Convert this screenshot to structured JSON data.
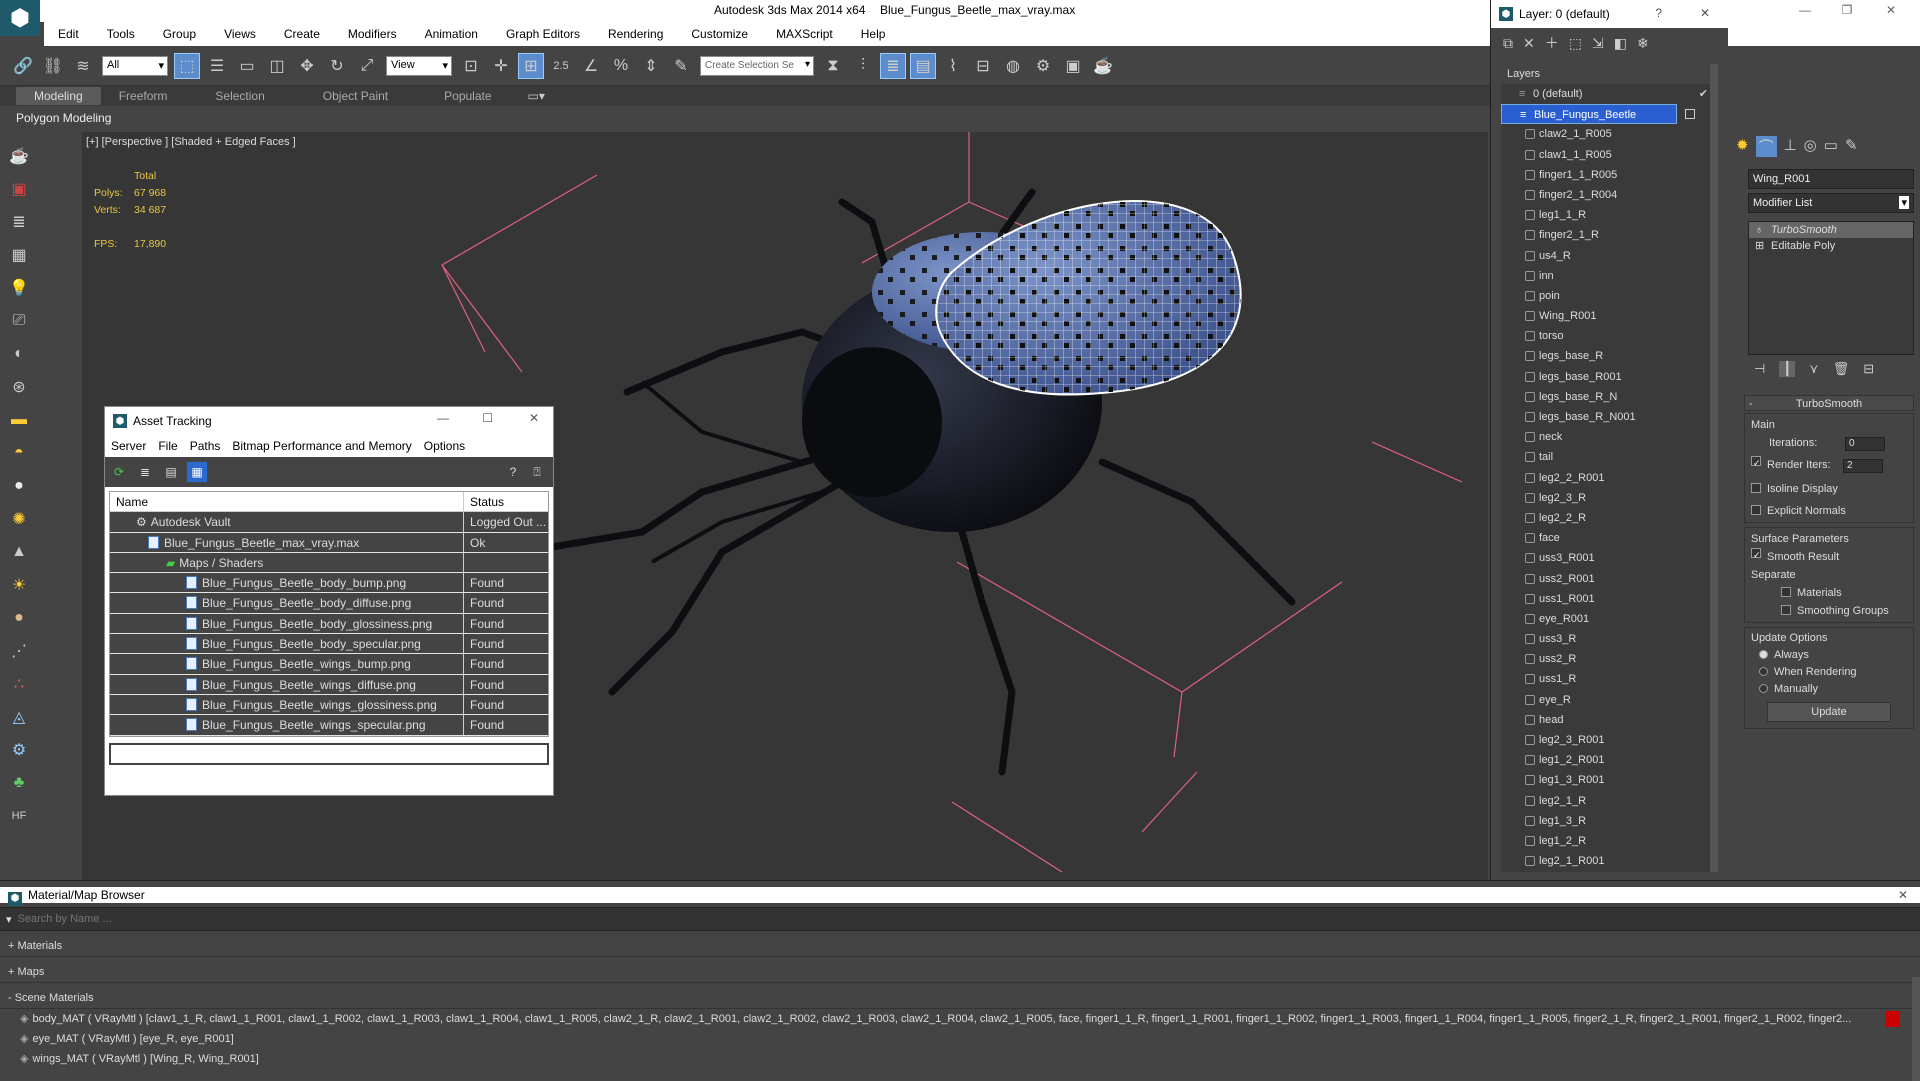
{
  "app": {
    "title": "Autodesk 3ds Max  2014 x64",
    "file": "Blue_Fungus_Beetle_max_vray.max"
  },
  "menu": [
    "Edit",
    "Tools",
    "Group",
    "Views",
    "Create",
    "Modifiers",
    "Animation",
    "Graph Editors",
    "Rendering",
    "Customize",
    "MAXScript",
    "Help"
  ],
  "toolbar": {
    "selection_filter": "All",
    "ref_coord": "View",
    "snap_value": "2.5",
    "named_selection": "Create Selection Se"
  },
  "ribbon_tabs": [
    "Modeling",
    "Freeform",
    "Selection",
    "Object Paint",
    "Populate"
  ],
  "polygon_modeling": "Polygon Modeling",
  "viewport": {
    "label": "[+] [Perspective ] [Shaded + Edged Faces ]",
    "stats": {
      "total_label": "Total",
      "polys_label": "Polys:",
      "polys": "67 968",
      "verts_label": "Verts:",
      "verts": "34 687",
      "fps_label": "FPS:",
      "fps": "17,890"
    }
  },
  "layers_panel": {
    "title": "Layer: 0 (default)",
    "help": "?",
    "header": "Layers",
    "default_layer": "0 (default)",
    "selected_layer": "Blue_Fungus_Beetle",
    "items": [
      "claw2_1_R005",
      "claw1_1_R005",
      "finger1_1_R005",
      "finger2_1_R004",
      "leg1_1_R",
      "finger2_1_R",
      "us4_R",
      "inn",
      "poin",
      "Wing_R001",
      "torso",
      "legs_base_R",
      "legs_base_R001",
      "legs_base_R_N",
      "legs_base_R_N001",
      "neck",
      "tail",
      "leg2_2_R001",
      "leg2_3_R",
      "leg2_2_R",
      "face",
      "uss3_R001",
      "uss2_R001",
      "uss1_R001",
      "eye_R001",
      "uss3_R",
      "uss2_R",
      "uss1_R",
      "eye_R",
      "head",
      "leg2_3_R001",
      "leg1_2_R001",
      "leg1_3_R001",
      "leg2_1_R",
      "leg1_3_R",
      "leg1_2_R",
      "leg2_1_R001"
    ]
  },
  "command_panel": {
    "object_name": "Wing_R001",
    "modifier_list": "Modifier List",
    "stack": [
      "TurboSmooth",
      "Editable Poly"
    ],
    "rollout_title": "TurboSmooth",
    "main_label": "Main",
    "iterations_label": "Iterations:",
    "iterations": "0",
    "render_iters_label": "Render Iters:",
    "render_iters": "2",
    "isoline": "Isoline Display",
    "explicit_normals": "Explicit Normals",
    "surface_params": "Surface Parameters",
    "smooth_result": "Smooth Result",
    "separate": "Separate",
    "materials": "Materials",
    "smoothing_groups": "Smoothing Groups",
    "update_options": "Update Options",
    "always": "Always",
    "when_rendering": "When Rendering",
    "manually": "Manually",
    "update_button": "Update"
  },
  "asset_tracking": {
    "title": "Asset Tracking",
    "menu": [
      "Server",
      "File",
      "Paths",
      "Bitmap Performance and Memory",
      "Options"
    ],
    "col_name": "Name",
    "col_status": "Status",
    "rows": [
      {
        "name": "Autodesk Vault",
        "status": "Logged Out ..."
      },
      {
        "name": "Blue_Fungus_Beetle_max_vray.max",
        "status": "Ok"
      },
      {
        "name": "Maps / Shaders",
        "status": ""
      },
      {
        "name": "Blue_Fungus_Beetle_body_bump.png",
        "status": "Found"
      },
      {
        "name": "Blue_Fungus_Beetle_body_diffuse.png",
        "status": "Found"
      },
      {
        "name": "Blue_Fungus_Beetle_body_glossiness.png",
        "status": "Found"
      },
      {
        "name": "Blue_Fungus_Beetle_body_specular.png",
        "status": "Found"
      },
      {
        "name": "Blue_Fungus_Beetle_wings_bump.png",
        "status": "Found"
      },
      {
        "name": "Blue_Fungus_Beetle_wings_diffuse.png",
        "status": "Found"
      },
      {
        "name": "Blue_Fungus_Beetle_wings_glossiness.png",
        "status": "Found"
      },
      {
        "name": "Blue_Fungus_Beetle_wings_specular.png",
        "status": "Found"
      }
    ]
  },
  "material_browser": {
    "title": "Material/Map Browser",
    "search_placeholder": "Search by Name ...",
    "materials": "+ Materials",
    "maps": "+ Maps",
    "scene_materials": "- Scene Materials",
    "entries": [
      "body_MAT  ( VRayMtl )  [claw1_1_R, claw1_1_R001, claw1_1_R002, claw1_1_R003, claw1_1_R004, claw1_1_R005, claw2_1_R, claw2_1_R001, claw2_1_R002, claw2_1_R003, claw2_1_R004, claw2_1_R005, face, finger1_1_R, finger1_1_R001, finger1_1_R002, finger1_1_R003, finger1_1_R004, finger1_1_R005, finger2_1_R, finger2_1_R001, finger2_1_R002, finger2...",
      "eye_MAT  ( VRayMtl )  [eye_R, eye_R001]",
      "wings_MAT  ( VRayMtl )  [Wing_R, Wing_R001]"
    ]
  },
  "colors": {
    "accent": "#2a5fd1",
    "wire": "#e06080",
    "selected_wire": "#ffffff"
  }
}
